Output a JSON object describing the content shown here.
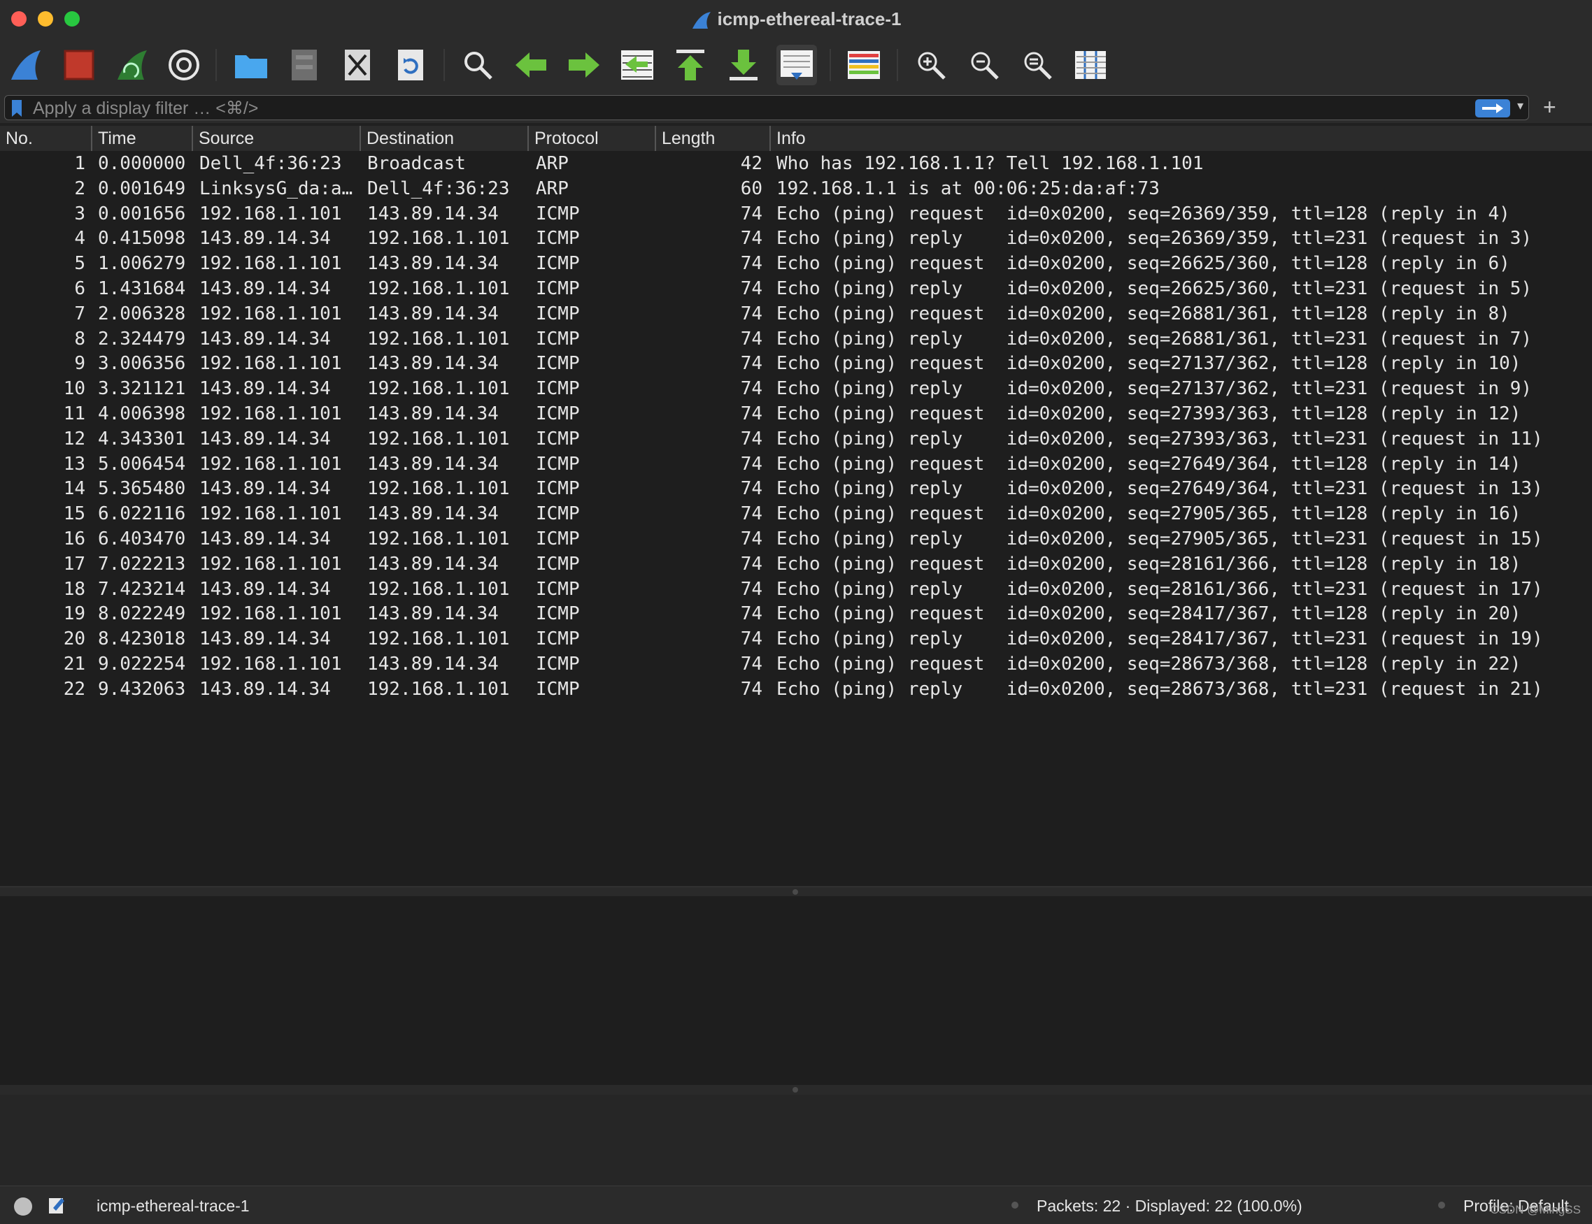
{
  "window": {
    "title": "icmp-ethereal-trace-1"
  },
  "toolbar": {
    "buttons": [
      {
        "name": "start-capture",
        "icon": "shark-fin-icon"
      },
      {
        "name": "stop-capture",
        "icon": "stop-square-icon"
      },
      {
        "name": "restart-capture",
        "icon": "restart-fin-icon"
      },
      {
        "name": "capture-options",
        "icon": "gear-icon"
      },
      {
        "name": "open-file",
        "icon": "folder-icon"
      },
      {
        "name": "save-file",
        "icon": "file-cabinet-icon"
      },
      {
        "name": "close-file",
        "icon": "close-file-icon"
      },
      {
        "name": "reload-file",
        "icon": "reload-icon"
      },
      {
        "name": "find-packet",
        "icon": "magnifier-icon"
      },
      {
        "name": "go-back",
        "icon": "arrow-left-icon"
      },
      {
        "name": "go-forward",
        "icon": "arrow-right-icon"
      },
      {
        "name": "go-to-packet",
        "icon": "go-to-packet-icon"
      },
      {
        "name": "first-packet",
        "icon": "arrow-top-icon"
      },
      {
        "name": "last-packet",
        "icon": "arrow-bottom-icon"
      },
      {
        "name": "autoscroll",
        "icon": "autoscroll-icon"
      },
      {
        "name": "colorize",
        "icon": "colorize-lines-icon"
      },
      {
        "name": "zoom-in",
        "icon": "zoom-in-icon"
      },
      {
        "name": "zoom-out",
        "icon": "zoom-out-icon"
      },
      {
        "name": "normal-size",
        "icon": "zoom-reset-icon"
      },
      {
        "name": "resize-columns",
        "icon": "resize-columns-icon"
      }
    ]
  },
  "filter": {
    "placeholder": "Apply a display filter … <⌘/>",
    "value": ""
  },
  "columns": [
    "No.",
    "Time",
    "Source",
    "Destination",
    "Protocol",
    "Length",
    "Info"
  ],
  "packets": [
    {
      "no": "1",
      "time": "0.000000",
      "src": "Dell_4f:36:23",
      "dst": "Broadcast",
      "proto": "ARP",
      "len": "42",
      "info": "Who has 192.168.1.1? Tell 192.168.1.101"
    },
    {
      "no": "2",
      "time": "0.001649",
      "src": "LinksysG_da:a…",
      "dst": "Dell_4f:36:23",
      "proto": "ARP",
      "len": "60",
      "info": "192.168.1.1 is at 00:06:25:da:af:73"
    },
    {
      "no": "3",
      "time": "0.001656",
      "src": "192.168.1.101",
      "dst": "143.89.14.34",
      "proto": "ICMP",
      "len": "74",
      "info": "Echo (ping) request  id=0x0200, seq=26369/359, ttl=128 (reply in 4)"
    },
    {
      "no": "4",
      "time": "0.415098",
      "src": "143.89.14.34",
      "dst": "192.168.1.101",
      "proto": "ICMP",
      "len": "74",
      "info": "Echo (ping) reply    id=0x0200, seq=26369/359, ttl=231 (request in 3)"
    },
    {
      "no": "5",
      "time": "1.006279",
      "src": "192.168.1.101",
      "dst": "143.89.14.34",
      "proto": "ICMP",
      "len": "74",
      "info": "Echo (ping) request  id=0x0200, seq=26625/360, ttl=128 (reply in 6)"
    },
    {
      "no": "6",
      "time": "1.431684",
      "src": "143.89.14.34",
      "dst": "192.168.1.101",
      "proto": "ICMP",
      "len": "74",
      "info": "Echo (ping) reply    id=0x0200, seq=26625/360, ttl=231 (request in 5)"
    },
    {
      "no": "7",
      "time": "2.006328",
      "src": "192.168.1.101",
      "dst": "143.89.14.34",
      "proto": "ICMP",
      "len": "74",
      "info": "Echo (ping) request  id=0x0200, seq=26881/361, ttl=128 (reply in 8)"
    },
    {
      "no": "8",
      "time": "2.324479",
      "src": "143.89.14.34",
      "dst": "192.168.1.101",
      "proto": "ICMP",
      "len": "74",
      "info": "Echo (ping) reply    id=0x0200, seq=26881/361, ttl=231 (request in 7)"
    },
    {
      "no": "9",
      "time": "3.006356",
      "src": "192.168.1.101",
      "dst": "143.89.14.34",
      "proto": "ICMP",
      "len": "74",
      "info": "Echo (ping) request  id=0x0200, seq=27137/362, ttl=128 (reply in 10)"
    },
    {
      "no": "10",
      "time": "3.321121",
      "src": "143.89.14.34",
      "dst": "192.168.1.101",
      "proto": "ICMP",
      "len": "74",
      "info": "Echo (ping) reply    id=0x0200, seq=27137/362, ttl=231 (request in 9)"
    },
    {
      "no": "11",
      "time": "4.006398",
      "src": "192.168.1.101",
      "dst": "143.89.14.34",
      "proto": "ICMP",
      "len": "74",
      "info": "Echo (ping) request  id=0x0200, seq=27393/363, ttl=128 (reply in 12)"
    },
    {
      "no": "12",
      "time": "4.343301",
      "src": "143.89.14.34",
      "dst": "192.168.1.101",
      "proto": "ICMP",
      "len": "74",
      "info": "Echo (ping) reply    id=0x0200, seq=27393/363, ttl=231 (request in 11)"
    },
    {
      "no": "13",
      "time": "5.006454",
      "src": "192.168.1.101",
      "dst": "143.89.14.34",
      "proto": "ICMP",
      "len": "74",
      "info": "Echo (ping) request  id=0x0200, seq=27649/364, ttl=128 (reply in 14)"
    },
    {
      "no": "14",
      "time": "5.365480",
      "src": "143.89.14.34",
      "dst": "192.168.1.101",
      "proto": "ICMP",
      "len": "74",
      "info": "Echo (ping) reply    id=0x0200, seq=27649/364, ttl=231 (request in 13)"
    },
    {
      "no": "15",
      "time": "6.022116",
      "src": "192.168.1.101",
      "dst": "143.89.14.34",
      "proto": "ICMP",
      "len": "74",
      "info": "Echo (ping) request  id=0x0200, seq=27905/365, ttl=128 (reply in 16)"
    },
    {
      "no": "16",
      "time": "6.403470",
      "src": "143.89.14.34",
      "dst": "192.168.1.101",
      "proto": "ICMP",
      "len": "74",
      "info": "Echo (ping) reply    id=0x0200, seq=27905/365, ttl=231 (request in 15)"
    },
    {
      "no": "17",
      "time": "7.022213",
      "src": "192.168.1.101",
      "dst": "143.89.14.34",
      "proto": "ICMP",
      "len": "74",
      "info": "Echo (ping) request  id=0x0200, seq=28161/366, ttl=128 (reply in 18)"
    },
    {
      "no": "18",
      "time": "7.423214",
      "src": "143.89.14.34",
      "dst": "192.168.1.101",
      "proto": "ICMP",
      "len": "74",
      "info": "Echo (ping) reply    id=0x0200, seq=28161/366, ttl=231 (request in 17)"
    },
    {
      "no": "19",
      "time": "8.022249",
      "src": "192.168.1.101",
      "dst": "143.89.14.34",
      "proto": "ICMP",
      "len": "74",
      "info": "Echo (ping) request  id=0x0200, seq=28417/367, ttl=128 (reply in 20)"
    },
    {
      "no": "20",
      "time": "8.423018",
      "src": "143.89.14.34",
      "dst": "192.168.1.101",
      "proto": "ICMP",
      "len": "74",
      "info": "Echo (ping) reply    id=0x0200, seq=28417/367, ttl=231 (request in 19)"
    },
    {
      "no": "21",
      "time": "9.022254",
      "src": "192.168.1.101",
      "dst": "143.89.14.34",
      "proto": "ICMP",
      "len": "74",
      "info": "Echo (ping) request  id=0x0200, seq=28673/368, ttl=128 (reply in 22)"
    },
    {
      "no": "22",
      "time": "9.432063",
      "src": "143.89.14.34",
      "dst": "192.168.1.101",
      "proto": "ICMP",
      "len": "74",
      "info": "Echo (ping) reply    id=0x0200, seq=28673/368, ttl=231 (request in 21)"
    }
  ],
  "status": {
    "file": "icmp-ethereal-trace-1",
    "packets": "Packets: 22 · Displayed: 22 (100.0%)",
    "profile": "Profile: Default",
    "watermark": "CSDN @MingSS"
  }
}
